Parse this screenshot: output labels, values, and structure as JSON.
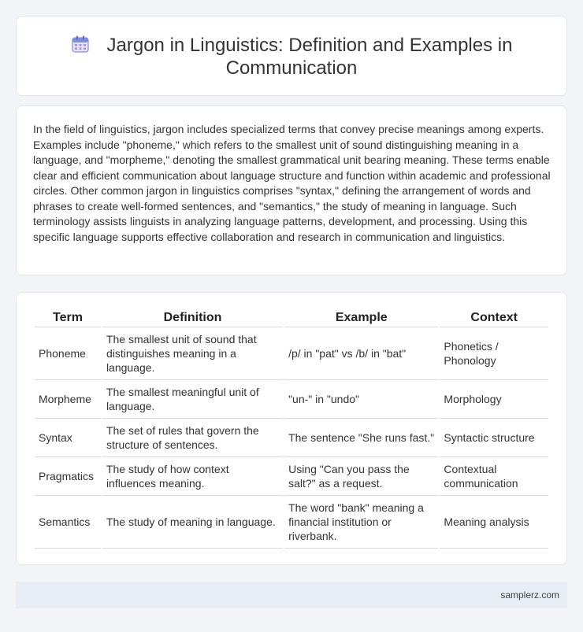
{
  "header": {
    "icon": "calendar-icon",
    "title_line1": "Jargon in Linguistics: Definition and Examples in",
    "title_line2": "Communication"
  },
  "intro": {
    "text": "In the field of linguistics, jargon includes specialized terms that convey precise meanings among experts. Examples include \"phoneme,\" which refers to the smallest unit of sound distinguishing meaning in a language, and \"morpheme,\" denoting the smallest grammatical unit bearing meaning. These terms enable clear and efficient communication about language structure and function within academic and professional circles. Other common jargon in linguistics comprises \"syntax,\" defining the arrangement of words and phrases to create well-formed sentences, and \"semantics,\" the study of meaning in language. Such terminology assists linguists in analyzing language patterns, development, and processing. Using this specific language supports effective collaboration and research in communication and linguistics."
  },
  "table": {
    "headers": [
      "Term",
      "Definition",
      "Example",
      "Context"
    ],
    "rows": [
      [
        "Phoneme",
        "The smallest unit of sound that distinguishes meaning in a language.",
        "/p/ in \"pat\" vs /b/ in \"bat\"",
        "Phonetics / Phonology"
      ],
      [
        "Morpheme",
        "The smallest meaningful unit of language.",
        "\"un-\" in \"undo\"",
        "Morphology"
      ],
      [
        "Syntax",
        "The set of rules that govern the structure of sentences.",
        "The sentence \"She runs fast.\"",
        "Syntactic structure"
      ],
      [
        "Pragmatics",
        "The study of how context influences meaning.",
        "Using \"Can you pass the salt?\" as a request.",
        "Contextual communication"
      ],
      [
        "Semantics",
        "The study of meaning in language.",
        "The word \"bank\" meaning a financial institution or riverbank.",
        "Meaning analysis"
      ]
    ]
  },
  "footer": {
    "site": "samplerz.com"
  }
}
